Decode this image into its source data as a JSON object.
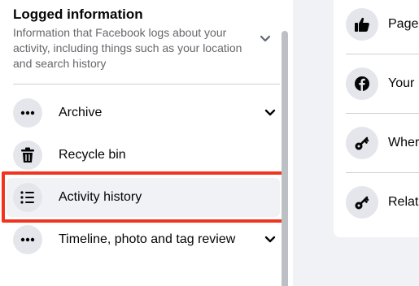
{
  "logged": {
    "title": "Logged information",
    "description": "Information that Facebook logs about your activity, including things such as your location and search history"
  },
  "items": [
    {
      "label": "Archive",
      "icon": "more-dots-icon"
    },
    {
      "label": "Recycle bin",
      "icon": "trash-icon"
    },
    {
      "label": "Activity history",
      "icon": "list-icon"
    },
    {
      "label": "Timeline, photo and tag review",
      "icon": "more-dots-icon"
    }
  ],
  "right_items": [
    {
      "label": "Page",
      "icon": "thumbs-up-icon"
    },
    {
      "label": "Your",
      "icon": "facebook-logo-icon"
    },
    {
      "label": "Wher",
      "icon": "key-icon"
    },
    {
      "label": "Relat",
      "icon": "key-icon"
    }
  ],
  "colors": {
    "highlight": "#f0341e",
    "icon_bg": "#e4e6eb",
    "secondary_text": "#65676b"
  }
}
